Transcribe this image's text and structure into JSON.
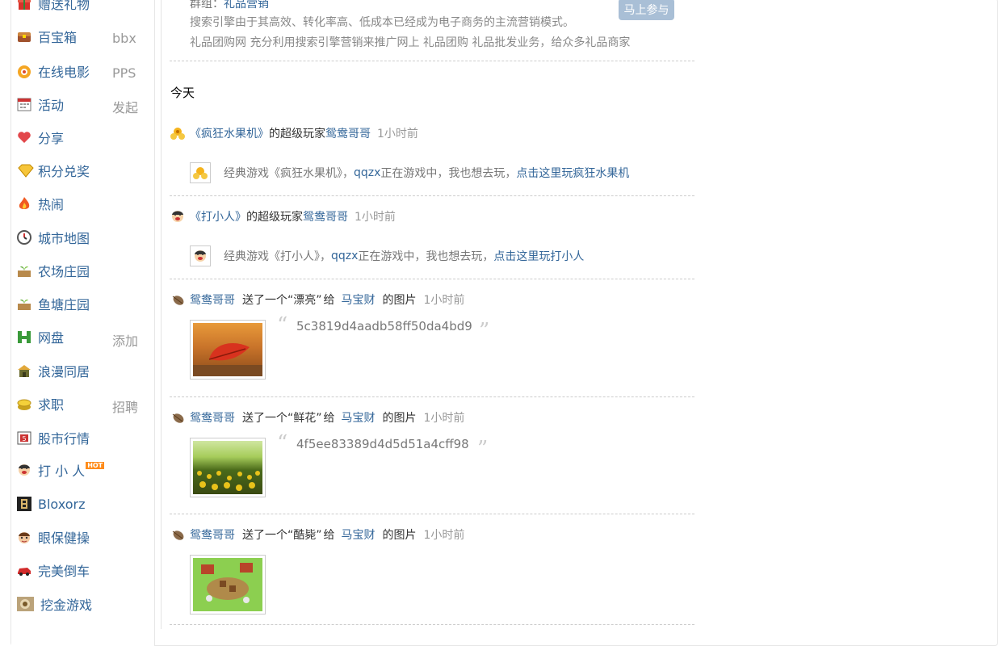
{
  "sidebar": {
    "items": [
      {
        "label": "赠送礼物",
        "extra": "",
        "icon": "gift-icon"
      },
      {
        "label": "百宝箱",
        "extra": "bbx",
        "icon": "treasure-box-icon"
      },
      {
        "label": "在线电影",
        "extra": "PPS",
        "icon": "movie-icon"
      },
      {
        "label": "活动",
        "extra": "发起",
        "icon": "calendar-icon"
      },
      {
        "label": "分享",
        "extra": "",
        "icon": "heart-share-icon"
      },
      {
        "label": "积分兑奖",
        "extra": "",
        "icon": "diamond-icon"
      },
      {
        "label": "热闹",
        "extra": "",
        "icon": "fire-icon"
      },
      {
        "label": "城市地图",
        "extra": "",
        "icon": "compass-icon"
      },
      {
        "label": "农场庄园",
        "extra": "",
        "icon": "farm-icon"
      },
      {
        "label": "鱼塘庄园",
        "extra": "",
        "icon": "fishpond-icon"
      },
      {
        "label": "网盘",
        "extra": "添加",
        "icon": "disk-icon"
      },
      {
        "label": "浪漫同居",
        "extra": "",
        "icon": "house-icon"
      },
      {
        "label": "求职",
        "extra": "招聘",
        "icon": "coin-icon"
      },
      {
        "label": "股市行情",
        "extra": "",
        "icon": "stock-icon"
      },
      {
        "label": "打 小 人",
        "extra": "",
        "icon": "face-icon",
        "badge": "HOT"
      },
      {
        "label": "Bloxorz",
        "extra": "",
        "icon": "bloxorz-icon"
      },
      {
        "label": "眼保健操",
        "extra": "",
        "icon": "eye-face-icon"
      },
      {
        "label": "完美倒车",
        "extra": "",
        "icon": "car-icon"
      },
      {
        "label": "挖金游戏",
        "extra": "",
        "icon": "gold-icon"
      }
    ]
  },
  "ad": {
    "group_prefix": "群组：",
    "group_name": "礼品营销",
    "line1": "搜索引擎由于其高效、转化率高、低成本已经成为电子商务的主流营销模式。",
    "line2": "礼品团购网 充分利用搜索引擎营销来推广网上 礼品团购 礼品批发业务，给众多礼品商家",
    "join_button": "马上参与"
  },
  "feed": {
    "day_label": "今天",
    "entries": [
      {
        "game": "《疯狂水果机》",
        "mid": " 的超级玩家",
        "user": "鸳鸯哥哥",
        "time": "1小时前",
        "sub_pre": "经典游戏《疯狂水果机》，",
        "sub_user": "qqzx",
        "sub_mid": "正在游戏中，我也想去玩，",
        "sub_link": "点击这里玩疯狂水果机"
      },
      {
        "game": "《打小人》",
        "mid": " 的超级玩家",
        "user": "鸳鸯哥哥",
        "time": "1小时前",
        "sub_pre": "经典游戏《打小人》，",
        "sub_user": "qqzx",
        "sub_mid": "正在游戏中，我也想去玩，",
        "sub_link": "点击这里玩打小人"
      }
    ],
    "gifts": [
      {
        "from": "鸳鸯哥哥",
        "text1": "送了一个",
        "gift": "“漂亮”",
        "text2": "给",
        "to": "马宝财",
        "text3": "的图片",
        "time": "1小时前",
        "hash": "5c3819d4aadb58ff50da4bd9",
        "photo": "red-leaf-photo"
      },
      {
        "from": "鸳鸯哥哥",
        "text1": "送了一个",
        "gift": "“鲜花”",
        "text2": "给",
        "to": "马宝财",
        "text3": "的图片",
        "time": "1小时前",
        "hash": "4f5ee83389d4d5d51a4cff98",
        "photo": "sunflower-field-photo"
      },
      {
        "from": "鸳鸯哥哥",
        "text1": "送了一个",
        "gift": "“酷毙”",
        "text2": "给",
        "to": "马宝财",
        "text3": "的图片",
        "time": "1小时前",
        "hash": "",
        "photo": "farm-game-photo"
      }
    ]
  },
  "colors": {
    "link": "#336699",
    "gray": "#777777",
    "time": "#999999",
    "join_button": "#a9bfd6"
  }
}
